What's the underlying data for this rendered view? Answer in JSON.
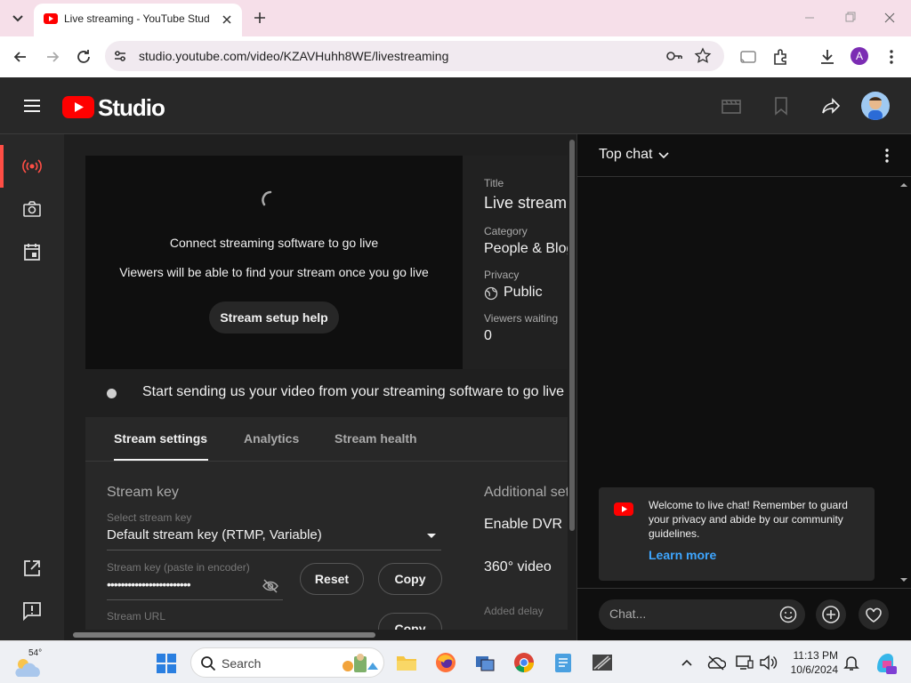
{
  "browser": {
    "tab_title": "Live streaming - YouTube Studio",
    "url": "studio.youtube.com/video/KZAVHuhh8WE/livestreaming",
    "profile_initial": "A"
  },
  "header": {
    "logo_text": "Studio"
  },
  "preview": {
    "line1": "Connect streaming software to go live",
    "line2": "Viewers will be able to find your stream once you go live",
    "help_button": "Stream setup help"
  },
  "meta": {
    "title_label": "Title",
    "title_value": "Live stream",
    "category_label": "Category",
    "category_value": "People & Blogs",
    "privacy_label": "Privacy",
    "privacy_value": "Public",
    "viewers_label": "Viewers waiting",
    "viewers_value": "0"
  },
  "status": {
    "message": "Start sending us your video from your streaming software to go live"
  },
  "tabs": [
    {
      "label": "Stream settings"
    },
    {
      "label": "Analytics"
    },
    {
      "label": "Stream health"
    }
  ],
  "settings": {
    "stream_key_heading": "Stream key",
    "select_label": "Select stream key",
    "select_value": "Default stream key (RTMP, Variable)",
    "key_label": "Stream key (paste in encoder)",
    "key_value": "••••••••••••••••••••••••",
    "reset_button": "Reset",
    "copy_button": "Copy",
    "url_label": "Stream URL",
    "url_copy_button": "Copy",
    "additional_heading": "Additional settings",
    "enable_dvr": "Enable DVR",
    "video_360": "360° video",
    "added_delay_label": "Added delay"
  },
  "chat": {
    "mode": "Top chat",
    "welcome": "Welcome to live chat! Remember to guard your privacy and abide by our community guidelines.",
    "learn_more": "Learn more",
    "input_placeholder": "Chat..."
  },
  "taskbar": {
    "temperature": "54°",
    "search_placeholder": "Search",
    "time": "11:13 PM",
    "date": "10/6/2024"
  },
  "colors": {
    "accent_red": "#ff0000",
    "link_blue": "#3ea6ff",
    "dark_bg": "#1f1f1f"
  }
}
